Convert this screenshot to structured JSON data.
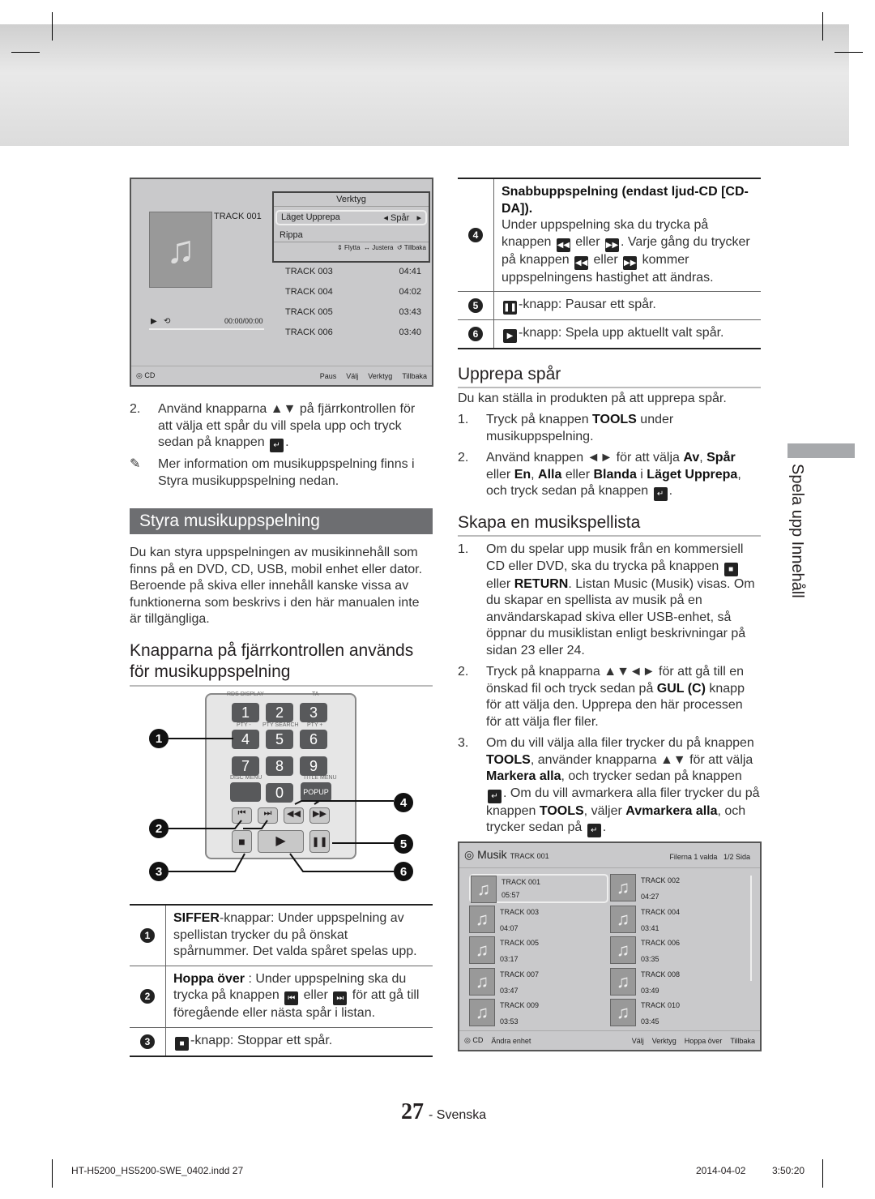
{
  "screen1": {
    "title": "Verktyg",
    "track": "TRACK 001",
    "menu": [
      {
        "label": "Läget Upprepa",
        "value": "Spår"
      },
      {
        "label": "Rippa"
      }
    ],
    "menu_hints": [
      "Flytta",
      "Justera",
      "Tillbaka"
    ],
    "time": "00:00/00:00",
    "tracks": [
      {
        "name": "TRACK 003",
        "dur": "04:41"
      },
      {
        "name": "TRACK 004",
        "dur": "04:02"
      },
      {
        "name": "TRACK 005",
        "dur": "03:43"
      },
      {
        "name": "TRACK 006",
        "dur": "03:40"
      }
    ],
    "source": "CD",
    "footer": [
      "Paus",
      "Välj",
      "Verktyg",
      "Tillbaka"
    ]
  },
  "left": {
    "step2": [
      {
        "t": "Använd knapparna ▲▼ på fjärrkontrollen för att välja ett spår du vill spela upp och tryck sedan på knappen "
      },
      {
        "i": "↵"
      },
      {
        "t": "."
      }
    ],
    "step2_num": "2.",
    "note": "Mer information om musikuppspelning finns i Styra musikuppspelning nedan.",
    "section": "Styra musikuppspelning",
    "intro": "Du kan styra uppspelningen av musikinnehåll som finns på en DVD, CD, USB, mobil enhet eller dator. Beroende på skiva eller innehåll kanske vissa av funktionerna som beskrivs i den här manualen inte är tillgängliga.",
    "subhead": "Knapparna på fjärrkontrollen används för musikuppspelning",
    "table": [
      {
        "n": "1",
        "text": [
          {
            "t": "SIFFER",
            "b": 1
          },
          {
            "t": "-knappar: Under uppspelning av spellistan trycker du på önskat spårnummer. Det valda spåret spelas upp."
          }
        ]
      },
      {
        "n": "2",
        "text": [
          {
            "t": "Hoppa över",
            "b": 1
          },
          {
            "t": " : Under uppspelning ska du trycka på knappen "
          },
          {
            "i": "⏮"
          },
          {
            "t": " eller "
          },
          {
            "i": "⏭"
          },
          {
            "t": " för att gå till föregående eller nästa spår i listan."
          }
        ]
      },
      {
        "n": "3",
        "text": [
          {
            "i": "■"
          },
          {
            "t": "-knapp: Stoppar ett spår."
          }
        ]
      }
    ]
  },
  "remote": {
    "labels": [
      "RDS DISPLAY",
      "TA",
      "PTY -",
      "PTY SEARCH",
      "PTY +",
      "DISC MENU",
      "TITLE MENU",
      "POPUP"
    ],
    "digits": [
      "1",
      "2",
      "3",
      "4",
      "5",
      "6",
      "7",
      "8",
      "9",
      "0"
    ],
    "callouts": [
      "1",
      "2",
      "3",
      "4",
      "5",
      "6"
    ]
  },
  "right": {
    "table": [
      {
        "n": "4",
        "text": [
          {
            "t": "Snabbuppspelning (endast ljud-CD [CD-DA]).",
            "b": 1
          },
          {
            "br": 1
          },
          {
            "t": "Under uppspelning ska du trycka på knappen "
          },
          {
            "i": "◀◀"
          },
          {
            "t": " eller "
          },
          {
            "i": "▶▶"
          },
          {
            "t": ". Varje gång du trycker på knappen "
          },
          {
            "i": "◀◀"
          },
          {
            "t": " eller "
          },
          {
            "i": "▶▶"
          },
          {
            "t": " kommer uppspelningens hastighet att ändras."
          }
        ]
      },
      {
        "n": "5",
        "text": [
          {
            "i": "❚❚"
          },
          {
            "t": "-knapp: Pausar ett spår."
          }
        ]
      },
      {
        "n": "6",
        "text": [
          {
            "i": "▶"
          },
          {
            "t": "-knapp: Spela upp aktuellt valt spår."
          }
        ]
      }
    ],
    "repeat_title": "Upprepa spår",
    "repeat_intro": "Du kan ställa in produkten på att upprepa spår.",
    "repeat_steps": [
      {
        "n": "1.",
        "text": [
          {
            "t": "Tryck på knappen "
          },
          {
            "t": "TOOLS",
            "b": 1
          },
          {
            "t": " under musikuppspelning."
          }
        ]
      },
      {
        "n": "2.",
        "text": [
          {
            "t": "Använd knappen ◄► för att välja "
          },
          {
            "t": "Av",
            "b": 1
          },
          {
            "t": ", "
          },
          {
            "t": "Spår",
            "b": 1
          },
          {
            "t": " eller "
          },
          {
            "t": "En",
            "b": 1
          },
          {
            "t": ", "
          },
          {
            "t": "Alla",
            "b": 1
          },
          {
            "t": " eller "
          },
          {
            "t": "Blanda",
            "b": 1
          },
          {
            "t": " i "
          },
          {
            "t": "Läget Upprepa",
            "b": 1
          },
          {
            "t": ", och tryck sedan på knappen "
          },
          {
            "i": "↵"
          },
          {
            "t": "."
          }
        ]
      }
    ],
    "playlist_title": "Skapa en musikspellista",
    "playlist_steps": [
      {
        "n": "1.",
        "text": [
          {
            "t": "Om du spelar upp musik från en kommersiell CD eller DVD, ska du trycka på knappen "
          },
          {
            "i": "■"
          },
          {
            "t": " eller "
          },
          {
            "t": "RETURN",
            "b": 1
          },
          {
            "t": ". Listan Music (Musik) visas. Om du skapar en spellista av musik på en användarskapad skiva eller USB-enhet, så öppnar du musiklistan enligt beskrivningar på sidan 23 eller 24."
          }
        ]
      },
      {
        "n": "2.",
        "text": [
          {
            "t": "Tryck på knapparna ▲▼◄► för att gå till en önskad fil och tryck sedan på "
          },
          {
            "t": "GUL (C)",
            "b": 1
          },
          {
            "t": " knapp för att välja den. Upprepa den här processen för att välja fler filer."
          }
        ]
      },
      {
        "n": "3.",
        "text": [
          {
            "t": "Om du vill välja alla filer trycker du på knappen "
          },
          {
            "t": "TOOLS",
            "b": 1
          },
          {
            "t": ", använder knapparna ▲▼ för att välja "
          },
          {
            "t": "Markera alla",
            "b": 1
          },
          {
            "t": ", och trycker sedan på knappen "
          },
          {
            "i": "↵"
          },
          {
            "t": ". Om du vill avmarkera alla filer trycker du på knappen "
          },
          {
            "t": "TOOLS",
            "b": 1
          },
          {
            "t": ", väljer "
          },
          {
            "t": "Avmarkera alla",
            "b": 1
          },
          {
            "t": ", och trycker sedan på "
          },
          {
            "i": "↵"
          },
          {
            "t": "."
          }
        ]
      }
    ]
  },
  "screen2": {
    "title": "Musik",
    "track": "TRACK 001",
    "selected": "Filerna 1 valda",
    "page": "1/2 Sida",
    "tracks": [
      {
        "name": "TRACK 001",
        "dur": "05:57"
      },
      {
        "name": "TRACK 002",
        "dur": "04:27"
      },
      {
        "name": "TRACK 003",
        "dur": "04:07"
      },
      {
        "name": "TRACK 004",
        "dur": "03:41"
      },
      {
        "name": "TRACK 005",
        "dur": "03:17"
      },
      {
        "name": "TRACK 006",
        "dur": "03:35"
      },
      {
        "name": "TRACK 007",
        "dur": "03:47"
      },
      {
        "name": "TRACK 008",
        "dur": "03:49"
      },
      {
        "name": "TRACK 009",
        "dur": "03:53"
      },
      {
        "name": "TRACK 010",
        "dur": "03:45"
      }
    ],
    "source": "CD",
    "footer": [
      "Ändra enhet",
      "Välj",
      "Verktyg",
      "Hoppa över",
      "Tillbaka"
    ]
  },
  "side_tab": "Spela upp Innehåll",
  "page_number": "27",
  "language": "- Svenska",
  "slug": {
    "file": "HT-H5200_HS5200-SWE_0402.indd   27",
    "date": "2014-04-02",
    "time": "3:50:20"
  }
}
